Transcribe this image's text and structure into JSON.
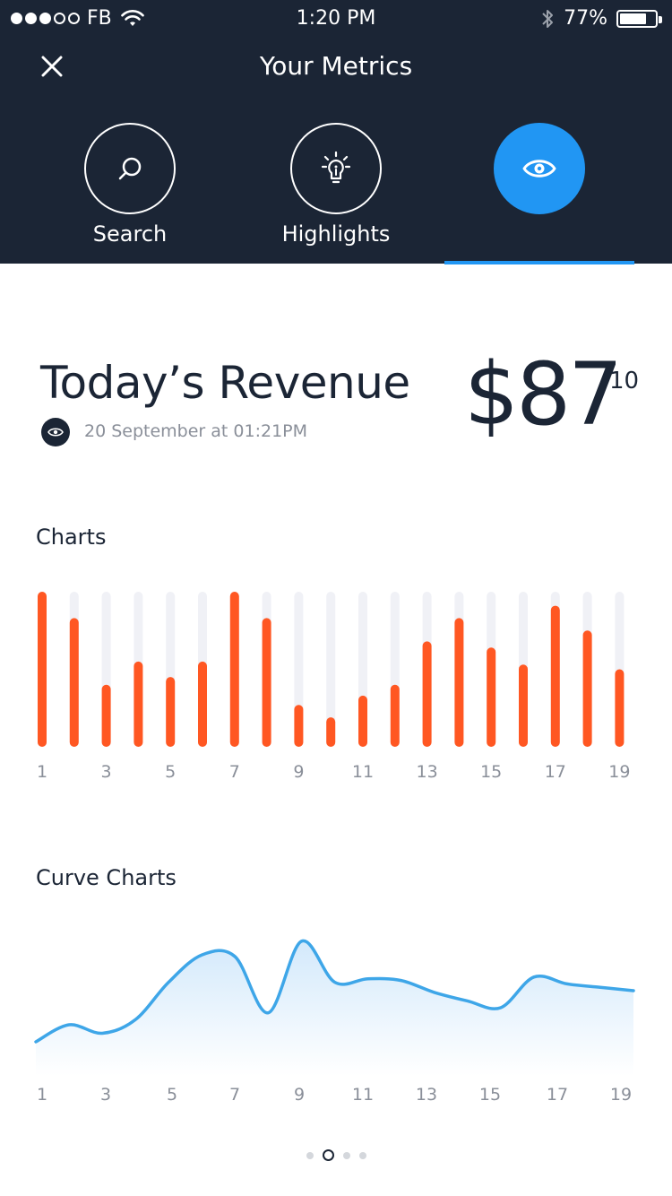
{
  "status_bar": {
    "carrier": "FB",
    "time": "1:20 PM",
    "battery": "77%",
    "battery_level": 0.77,
    "signal_bars_filled": 3,
    "signal_bars_total": 5
  },
  "header": {
    "title": "Your Metrics",
    "close_icon": "close-icon",
    "tabs": [
      {
        "label": "Search",
        "icon": "search-icon",
        "active": false
      },
      {
        "label": "Highlights",
        "icon": "lightbulb-icon",
        "active": false
      },
      {
        "label": "",
        "icon": "eye-icon",
        "active": true
      }
    ]
  },
  "revenue": {
    "title": "Today’s Revenue",
    "date": "20 September at 01:21PM",
    "amount": "$87",
    "cents": "10"
  },
  "sections": {
    "charts_title": "Charts",
    "curve_title": "Curve Charts"
  },
  "colors": {
    "header_bg": "#1b2535",
    "accent_blue": "#2196f3",
    "bar_orange": "#ff5722",
    "bar_track": "#f0f1f6",
    "curve_line": "#3ea6e8"
  },
  "chart_data": [
    {
      "type": "bar",
      "categories": [
        "1",
        "2",
        "3",
        "4",
        "5",
        "6",
        "7",
        "8",
        "9",
        "10",
        "11",
        "12",
        "13",
        "14",
        "15",
        "16",
        "17",
        "18",
        "19"
      ],
      "tick_labels": [
        "1",
        "3",
        "5",
        "7",
        "9",
        "11",
        "13",
        "15",
        "17",
        "19"
      ],
      "values": [
        100,
        83,
        40,
        55,
        45,
        55,
        100,
        83,
        27,
        19,
        33,
        40,
        68,
        83,
        64,
        53,
        91,
        75,
        50
      ],
      "ylim": [
        0,
        100
      ]
    },
    {
      "type": "area",
      "x": [
        1,
        2,
        3,
        4,
        5,
        6,
        7,
        8,
        9,
        10,
        11,
        12,
        13,
        14,
        15,
        16,
        17,
        18,
        19
      ],
      "tick_labels": [
        "1",
        "3",
        "5",
        "7",
        "9",
        "11",
        "13",
        "15",
        "17",
        "19"
      ],
      "values": [
        20,
        30,
        25,
        33,
        55,
        71,
        70,
        37,
        79,
        55,
        57,
        56,
        49,
        44,
        40,
        58,
        54,
        52,
        50
      ],
      "ylim": [
        0,
        100
      ]
    }
  ],
  "pager": {
    "count": 4,
    "active_index": 1
  }
}
